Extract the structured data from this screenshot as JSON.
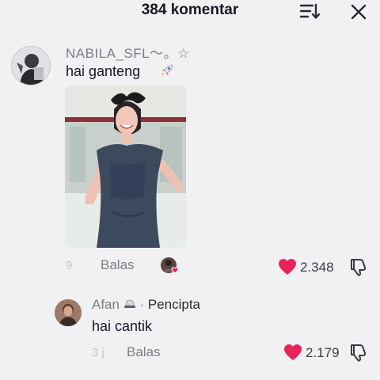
{
  "header": {
    "title": "384 komentar",
    "sort_icon": "sort-lines-icon",
    "close_icon": "close-icon"
  },
  "comments": [
    {
      "username": "NABILA_SFL〜。☆",
      "text": "hai ganteng",
      "emoji_icon": "rocket-icon",
      "has_image": true,
      "time": "9",
      "reply_label": "Balas",
      "likes": "2.348",
      "liked_by_creator": true
    }
  ],
  "reply": {
    "username": "Afan",
    "badge_icon": "hat-icon",
    "separator": "·",
    "creator_label": "Pencipta",
    "text": "hai cantik",
    "time": "3 j",
    "reply_label": "Balas",
    "likes": "2.179"
  },
  "colors": {
    "background": "#f1f1f3",
    "like_red": "#e5245a",
    "text_primary": "#161823",
    "text_secondary": "#7c7d84"
  }
}
